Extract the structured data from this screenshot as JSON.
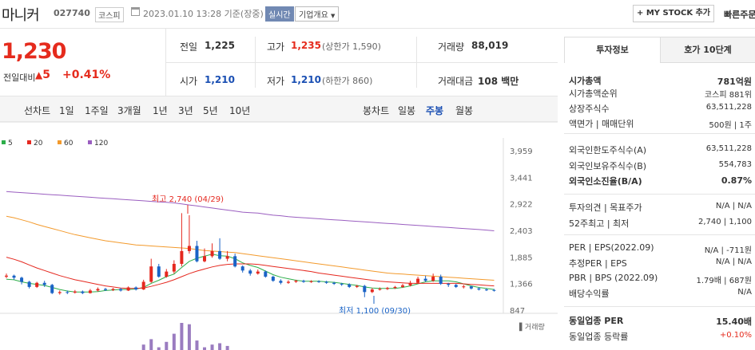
{
  "header": {
    "name": "마니커",
    "code": "027740",
    "market": "코스피",
    "datetime": "2023.01.10 13:28 기준(장중)",
    "live": "실시간",
    "corp": "기업개요",
    "mystock": "MY STOCK 추가",
    "quick": "빠른주문"
  },
  "price": {
    "current": "1,230",
    "change_label": "전일대비",
    "change": "5",
    "pct": "+0.41%",
    "prev_label": "전일",
    "prev": "1,225",
    "high_label": "고가",
    "high": "1,235",
    "upper": "(상한가 1,590)",
    "vol_label": "거래량",
    "vol": "88,019",
    "open_label": "시가",
    "open": "1,210",
    "low_label": "저가",
    "low": "1,210",
    "lower": "(하한가 860)",
    "amt_label": "거래대금",
    "amt": "108 백만"
  },
  "periods": {
    "line_label": "선차트",
    "line_items": [
      "1일",
      "1주일",
      "3개월",
      "1년",
      "3년",
      "5년",
      "10년"
    ],
    "candle_label": "봉차트",
    "candle_items": [
      "일봉",
      "주봉",
      "월봉"
    ],
    "active": "주봉"
  },
  "legend": [
    {
      "name": "5",
      "color": "#2dae4a"
    },
    {
      "name": "20",
      "color": "#e5281f"
    },
    {
      "name": "60",
      "color": "#f39a2c"
    },
    {
      "name": "120",
      "color": "#9a5ec0"
    }
  ],
  "chart_data": {
    "type": "candlestick",
    "yticks": [
      "3,959",
      "3,441",
      "2,922",
      "2,403",
      "1,885",
      "1,366",
      "847"
    ],
    "ylim": [
      847,
      3959
    ],
    "high_note": "최고 2,740 (04/29)",
    "low_note": "최저 1,100 (09/30)",
    "volume_label": "거래량",
    "candles": [
      {
        "o": 1500,
        "c": 1520,
        "h": 1560,
        "l": 1470
      },
      {
        "o": 1520,
        "c": 1480,
        "h": 1540,
        "l": 1440
      },
      {
        "o": 1480,
        "c": 1400,
        "h": 1500,
        "l": 1350
      },
      {
        "o": 1400,
        "c": 1300,
        "h": 1420,
        "l": 1270
      },
      {
        "o": 1300,
        "c": 1380,
        "h": 1400,
        "l": 1280
      },
      {
        "o": 1380,
        "c": 1340,
        "h": 1420,
        "l": 1300
      },
      {
        "o": 1340,
        "c": 1180,
        "h": 1360,
        "l": 1160
      },
      {
        "o": 1180,
        "c": 1200,
        "h": 1230,
        "l": 1150
      },
      {
        "o": 1200,
        "c": 1190,
        "h": 1230,
        "l": 1160
      },
      {
        "o": 1190,
        "c": 1210,
        "h": 1240,
        "l": 1170
      },
      {
        "o": 1210,
        "c": 1180,
        "h": 1230,
        "l": 1160
      },
      {
        "o": 1180,
        "c": 1230,
        "h": 1260,
        "l": 1170
      },
      {
        "o": 1230,
        "c": 1260,
        "h": 1290,
        "l": 1210
      },
      {
        "o": 1260,
        "c": 1240,
        "h": 1280,
        "l": 1220
      },
      {
        "o": 1240,
        "c": 1260,
        "h": 1280,
        "l": 1220
      },
      {
        "o": 1260,
        "c": 1230,
        "h": 1280,
        "l": 1210
      },
      {
        "o": 1230,
        "c": 1290,
        "h": 1310,
        "l": 1220
      },
      {
        "o": 1290,
        "c": 1250,
        "h": 1310,
        "l": 1230
      },
      {
        "o": 1250,
        "c": 1400,
        "h": 1440,
        "l": 1240
      },
      {
        "o": 1400,
        "c": 1700,
        "h": 1850,
        "l": 1380
      },
      {
        "o": 1700,
        "c": 1500,
        "h": 1750,
        "l": 1480
      },
      {
        "o": 1500,
        "c": 1600,
        "h": 1650,
        "l": 1480
      },
      {
        "o": 1600,
        "c": 1750,
        "h": 1820,
        "l": 1560
      },
      {
        "o": 1750,
        "c": 2000,
        "h": 2740,
        "l": 1700
      },
      {
        "o": 2000,
        "c": 2100,
        "h": 2700,
        "l": 1950
      },
      {
        "o": 2100,
        "c": 1800,
        "h": 2200,
        "l": 1780
      },
      {
        "o": 1800,
        "c": 1900,
        "h": 2050,
        "l": 1780
      },
      {
        "o": 1900,
        "c": 2000,
        "h": 2150,
        "l": 1870
      },
      {
        "o": 2000,
        "c": 1850,
        "h": 2250,
        "l": 1830
      },
      {
        "o": 1850,
        "c": 1900,
        "h": 2000,
        "l": 1800
      },
      {
        "o": 1900,
        "c": 1700,
        "h": 1950,
        "l": 1680
      },
      {
        "o": 1700,
        "c": 1620,
        "h": 1720,
        "l": 1580
      },
      {
        "o": 1620,
        "c": 1560,
        "h": 1650,
        "l": 1520
      },
      {
        "o": 1560,
        "c": 1600,
        "h": 1640,
        "l": 1540
      },
      {
        "o": 1600,
        "c": 1500,
        "h": 1620,
        "l": 1480
      },
      {
        "o": 1500,
        "c": 1420,
        "h": 1520,
        "l": 1400
      },
      {
        "o": 1420,
        "c": 1380,
        "h": 1450,
        "l": 1350
      },
      {
        "o": 1380,
        "c": 1400,
        "h": 1430,
        "l": 1360
      },
      {
        "o": 1400,
        "c": 1420,
        "h": 1440,
        "l": 1380
      },
      {
        "o": 1420,
        "c": 1400,
        "h": 1440,
        "l": 1380
      },
      {
        "o": 1400,
        "c": 1410,
        "h": 1430,
        "l": 1380
      },
      {
        "o": 1410,
        "c": 1400,
        "h": 1430,
        "l": 1380
      },
      {
        "o": 1400,
        "c": 1380,
        "h": 1420,
        "l": 1360
      },
      {
        "o": 1380,
        "c": 1360,
        "h": 1400,
        "l": 1340
      },
      {
        "o": 1360,
        "c": 1350,
        "h": 1380,
        "l": 1320
      },
      {
        "o": 1350,
        "c": 1300,
        "h": 1370,
        "l": 1280
      },
      {
        "o": 1300,
        "c": 1320,
        "h": 1340,
        "l": 1280
      },
      {
        "o": 1320,
        "c": 1200,
        "h": 1340,
        "l": 1100
      },
      {
        "o": 1200,
        "c": 1250,
        "h": 1280,
        "l": 1180
      },
      {
        "o": 1250,
        "c": 1260,
        "h": 1290,
        "l": 1230
      },
      {
        "o": 1260,
        "c": 1280,
        "h": 1300,
        "l": 1240
      },
      {
        "o": 1280,
        "c": 1300,
        "h": 1320,
        "l": 1260
      },
      {
        "o": 1300,
        "c": 1330,
        "h": 1360,
        "l": 1280
      },
      {
        "o": 1330,
        "c": 1380,
        "h": 1420,
        "l": 1310
      },
      {
        "o": 1380,
        "c": 1460,
        "h": 1500,
        "l": 1360
      },
      {
        "o": 1460,
        "c": 1420,
        "h": 1520,
        "l": 1400
      },
      {
        "o": 1420,
        "c": 1500,
        "h": 1560,
        "l": 1400
      },
      {
        "o": 1500,
        "c": 1360,
        "h": 1540,
        "l": 1340
      },
      {
        "o": 1360,
        "c": 1340,
        "h": 1380,
        "l": 1300
      },
      {
        "o": 1340,
        "c": 1300,
        "h": 1360,
        "l": 1280
      },
      {
        "o": 1300,
        "c": 1310,
        "h": 1340,
        "l": 1270
      },
      {
        "o": 1310,
        "c": 1270,
        "h": 1320,
        "l": 1250
      },
      {
        "o": 1270,
        "c": 1250,
        "h": 1290,
        "l": 1230
      },
      {
        "o": 1250,
        "c": 1240,
        "h": 1270,
        "l": 1220
      },
      {
        "o": 1240,
        "c": 1230,
        "h": 1260,
        "l": 1210
      }
    ],
    "volumes": [
      0,
      0,
      0,
      0,
      0,
      0,
      0,
      0,
      0,
      0,
      0,
      0,
      0,
      0,
      0,
      0,
      0,
      0,
      0.2,
      0.4,
      0.1,
      0.3,
      0.6,
      1.0,
      0.95,
      0.35,
      0.1,
      0.2,
      0.25,
      0.15,
      0,
      0,
      0,
      0,
      0,
      0,
      0,
      0,
      0,
      0,
      0,
      0,
      0,
      0,
      0,
      0,
      0,
      0,
      0,
      0,
      0,
      0,
      0,
      0,
      0,
      0,
      0,
      0,
      0,
      0,
      0,
      0,
      0,
      0,
      0,
      0
    ],
    "series": [
      {
        "name": "5",
        "values": [
          1450,
          1440,
          1400,
          1370,
          1350,
          1330,
          1290,
          1250,
          1220,
          1200,
          1200,
          1200,
          1210,
          1230,
          1240,
          1250,
          1250,
          1260,
          1290,
          1370,
          1430,
          1500,
          1550,
          1680,
          1800,
          1860,
          1900,
          1940,
          1910,
          1900,
          1850,
          1770,
          1720,
          1680,
          1610,
          1540,
          1490,
          1460,
          1430,
          1410,
          1410,
          1410,
          1400,
          1390,
          1370,
          1350,
          1330,
          1300,
          1280,
          1270,
          1270,
          1270,
          1290,
          1320,
          1360,
          1400,
          1420,
          1420,
          1420,
          1400,
          1360,
          1320,
          1290,
          1270,
          1250
        ]
      },
      {
        "name": "20",
        "values": [
          1880,
          1840,
          1790,
          1730,
          1670,
          1620,
          1570,
          1520,
          1480,
          1440,
          1410,
          1380,
          1350,
          1320,
          1300,
          1280,
          1270,
          1270,
          1280,
          1310,
          1350,
          1390,
          1440,
          1500,
          1560,
          1610,
          1650,
          1690,
          1720,
          1740,
          1750,
          1750,
          1750,
          1740,
          1720,
          1700,
          1680,
          1660,
          1640,
          1620,
          1600,
          1570,
          1550,
          1530,
          1510,
          1490,
          1470,
          1450,
          1430,
          1410,
          1400,
          1390,
          1380,
          1370,
          1370,
          1370,
          1370,
          1370,
          1370,
          1370,
          1360,
          1350,
          1340,
          1330,
          1320
        ]
      },
      {
        "name": "60",
        "values": [
          2680,
          2650,
          2610,
          2570,
          2520,
          2480,
          2440,
          2400,
          2360,
          2320,
          2290,
          2260,
          2230,
          2200,
          2180,
          2160,
          2140,
          2120,
          2110,
          2100,
          2090,
          2080,
          2070,
          2060,
          2050,
          2030,
          2010,
          2000,
          1990,
          1980,
          1970,
          1950,
          1930,
          1910,
          1890,
          1870,
          1850,
          1830,
          1810,
          1790,
          1770,
          1750,
          1730,
          1710,
          1690,
          1670,
          1650,
          1630,
          1610,
          1590,
          1570,
          1560,
          1550,
          1540,
          1530,
          1520,
          1510,
          1500,
          1490,
          1480,
          1470,
          1460,
          1450,
          1440,
          1430
        ]
      },
      {
        "name": "120",
        "values": [
          3160,
          3150,
          3140,
          3130,
          3120,
          3110,
          3100,
          3090,
          3080,
          3070,
          3060,
          3050,
          3040,
          3030,
          3020,
          3010,
          3000,
          2990,
          2980,
          2970,
          2960,
          2950,
          2940,
          2920,
          2900,
          2880,
          2860,
          2840,
          2820,
          2800,
          2780,
          2760,
          2750,
          2740,
          2720,
          2700,
          2690,
          2670,
          2660,
          2650,
          2640,
          2630,
          2620,
          2610,
          2600,
          2590,
          2580,
          2570,
          2560,
          2550,
          2540,
          2530,
          2520,
          2510,
          2500,
          2490,
          2480,
          2470,
          2460,
          2450,
          2440,
          2430,
          2420,
          2410,
          2395
        ]
      }
    ]
  },
  "panel": {
    "tab_active": "투자정보",
    "tab_other": "호가 10단계",
    "rows": [
      {
        "k": "시가총액",
        "v": "781억원",
        "bold": true
      },
      {
        "k": "시가총액순위",
        "v": "코스피 881위"
      },
      {
        "k": "상장주식수",
        "v": "63,511,228"
      },
      {
        "k": "액면가 | 매매단위",
        "v": "500원 | 1주"
      },
      {
        "k": "외국인한도주식수(A)",
        "v": "63,511,228"
      },
      {
        "k": "외국인보유주식수(B)",
        "v": "554,783"
      },
      {
        "k": "외국인소진율(B/A)",
        "v": "0.87%",
        "bold": true
      },
      {
        "k": "투자의견 | 목표주가",
        "v": "N/A | N/A"
      },
      {
        "k": "52주최고 | 최저",
        "v": "2,740 | 1,100"
      },
      {
        "k": "PER | EPS(2022.09)",
        "v": "N/A | -711원"
      },
      {
        "k": "추정PER | EPS",
        "v": "N/A | N/A"
      },
      {
        "k": "PBR | BPS (2022.09)",
        "v": "1.79배 | 687원"
      },
      {
        "k": "배당수익률",
        "v": "N/A"
      },
      {
        "k": "동일업종 PER",
        "v": "15.40배",
        "bold": true
      },
      {
        "k": "동일업종 등락률",
        "v": "+0.10%",
        "red": true
      }
    ]
  }
}
